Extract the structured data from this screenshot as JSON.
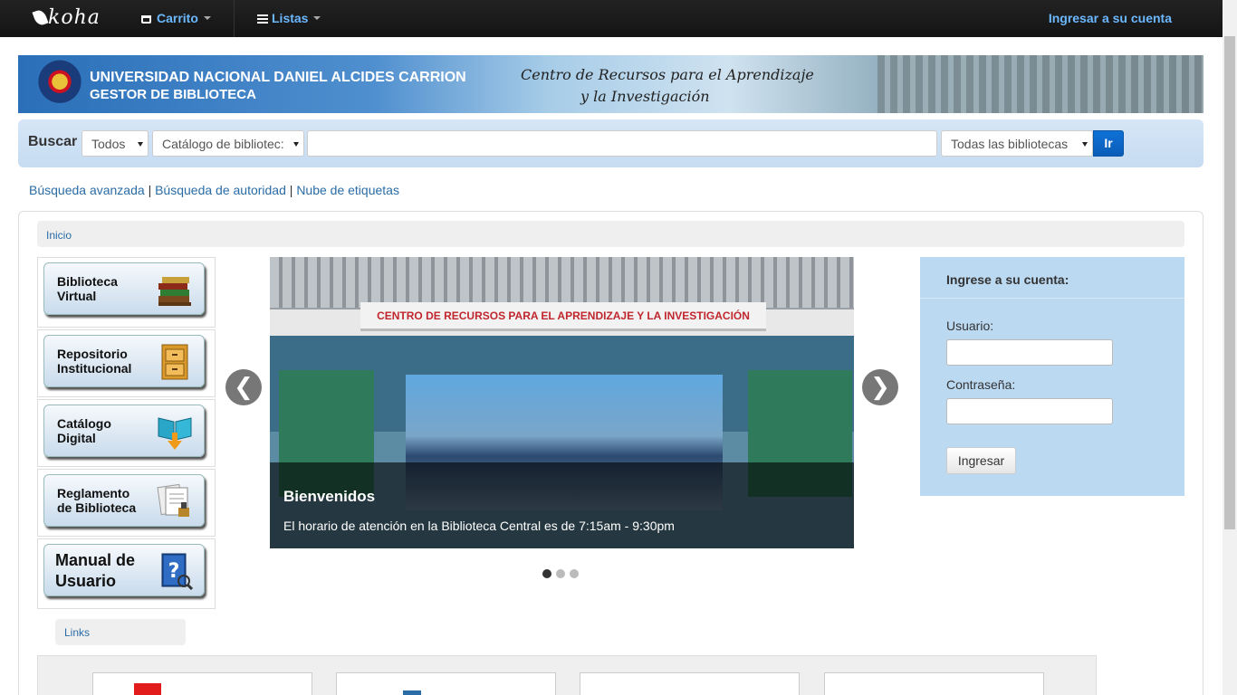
{
  "navbar": {
    "brand": "koha",
    "cart_label": "Carrito",
    "lists_label": "Listas",
    "login_label": "Ingresar a su cuenta"
  },
  "banner": {
    "title_line1": "UNIVERSIDAD NACIONAL DANIEL ALCIDES CARRION",
    "title_line2": "GESTOR DE BIBLIOTECA",
    "script_line1": "Centro de Recursos para el Aprendizaje",
    "script_line2": "y la Investigación"
  },
  "search": {
    "label": "Buscar",
    "scope_value": "Todos",
    "catalog_value": "Catálogo de bibliotec:",
    "query_value": "",
    "library_value": "Todas las bibliotecas",
    "go_label": "Ir"
  },
  "search_links": {
    "advanced": "Búsqueda avanzada",
    "authority": "Búsqueda de autoridad",
    "tags": "Nube de etiquetas",
    "separator": "|"
  },
  "breadcrumb": {
    "home": "Inicio"
  },
  "menu_tiles": [
    {
      "line1": "Biblioteca",
      "line2": "Virtual",
      "icon": "books-icon"
    },
    {
      "line1": "Repositorio",
      "line2": "Institucional",
      "icon": "file-cabinet-icon"
    },
    {
      "line1": "Catálogo",
      "line2": "Digital",
      "icon": "open-book-download-icon"
    },
    {
      "line1": "Reglamento",
      "line2": "de Biblioteca",
      "icon": "documents-icon"
    },
    {
      "line1": "Manual de",
      "line2": "Usuario",
      "icon": "help-manual-icon"
    }
  ],
  "carousel": {
    "sign_text": "CENTRO DE RECURSOS PARA EL APRENDIZAJE Y LA INVESTIGACIÓN",
    "caption_title": "Bienvenidos",
    "caption_text": "El horario de atención en la Biblioteca Central es de 7:15am - 9:30pm",
    "prev_glyph": "❮",
    "next_glyph": "❯",
    "slide_count": 3,
    "active_slide": 1
  },
  "login": {
    "title": "Ingrese a su cuenta:",
    "user_label": "Usuario:",
    "user_value": "",
    "password_label": "Contraseña:",
    "password_value": "",
    "submit_label": "Ingresar"
  },
  "links_section": {
    "label": "Links"
  },
  "colors": {
    "navbar_bg": "#1a1a1a",
    "nav_link": "#6cb8ff",
    "link": "#2a6ca6",
    "search_bar_bg": "#cfe2f5",
    "go_button": "#0d68c8",
    "login_panel_bg": "#bcd9f2",
    "sign_text": "#c0262d"
  }
}
